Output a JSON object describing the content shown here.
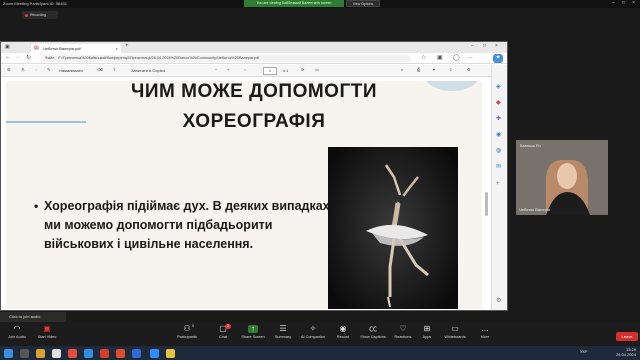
{
  "zoom": {
    "window_title": "Zoom Meeting Participant ID: 58401",
    "viewing_notice": "You are viewing Байбезький Валентин's screen",
    "view_options": "View Options",
    "recording": "Recording",
    "join_audio_tooltip": "Click to join audio",
    "participant_top_name": "Катюша Ро",
    "participant_bottom_name": "Чеботок Валерія",
    "toolbar": [
      {
        "label": "Join Audio",
        "icon": "headphones-icon"
      },
      {
        "label": "Start Video",
        "icon": "video-icon"
      },
      {
        "label": "Participants",
        "icon": "people-icon",
        "badge": "5"
      },
      {
        "label": "Chat",
        "icon": "chat-icon",
        "badge": "2"
      },
      {
        "label": "Share Screen",
        "icon": "share-icon"
      },
      {
        "label": "Summary",
        "icon": "summary-icon"
      },
      {
        "label": "AI Companion",
        "icon": "ai-icon"
      },
      {
        "label": "Record",
        "icon": "record-icon"
      },
      {
        "label": "Show Captions",
        "icon": "cc-icon"
      },
      {
        "label": "Reactions",
        "icon": "heart-icon"
      },
      {
        "label": "Apps",
        "icon": "apps-icon"
      },
      {
        "label": "Whiteboards",
        "icon": "whiteboard-icon"
      },
      {
        "label": "More",
        "icon": "more-icon"
      }
    ],
    "leave": "Leave"
  },
  "browser": {
    "tab_title": "Чеботок Валерія.pdf",
    "address_prefix": "Файл",
    "address": "F:/Гринченка%20Київський/Конференції/Презентації/26.04.2024%20Dance%20Community/Чеботок%20Валерія.pdf",
    "pdf_toolbar": {
      "draw_label": "Намалювати",
      "copilot_label": "Запитати в Copilot",
      "page_current": "1",
      "page_total": "з 1"
    }
  },
  "slide": {
    "title_line1": "ЧИМ МОЖЕ ДОПОМОГТИ",
    "title_line2": "ХОРЕОГРАФІЯ",
    "bullet": "Хореографія підіймає дух.  В деяких випадках ми можемо допомогти підбадьорити військових і цивільне населення."
  },
  "taskbar": {
    "time": "13:29",
    "date": "26.04.2024",
    "lang": "УКР"
  }
}
